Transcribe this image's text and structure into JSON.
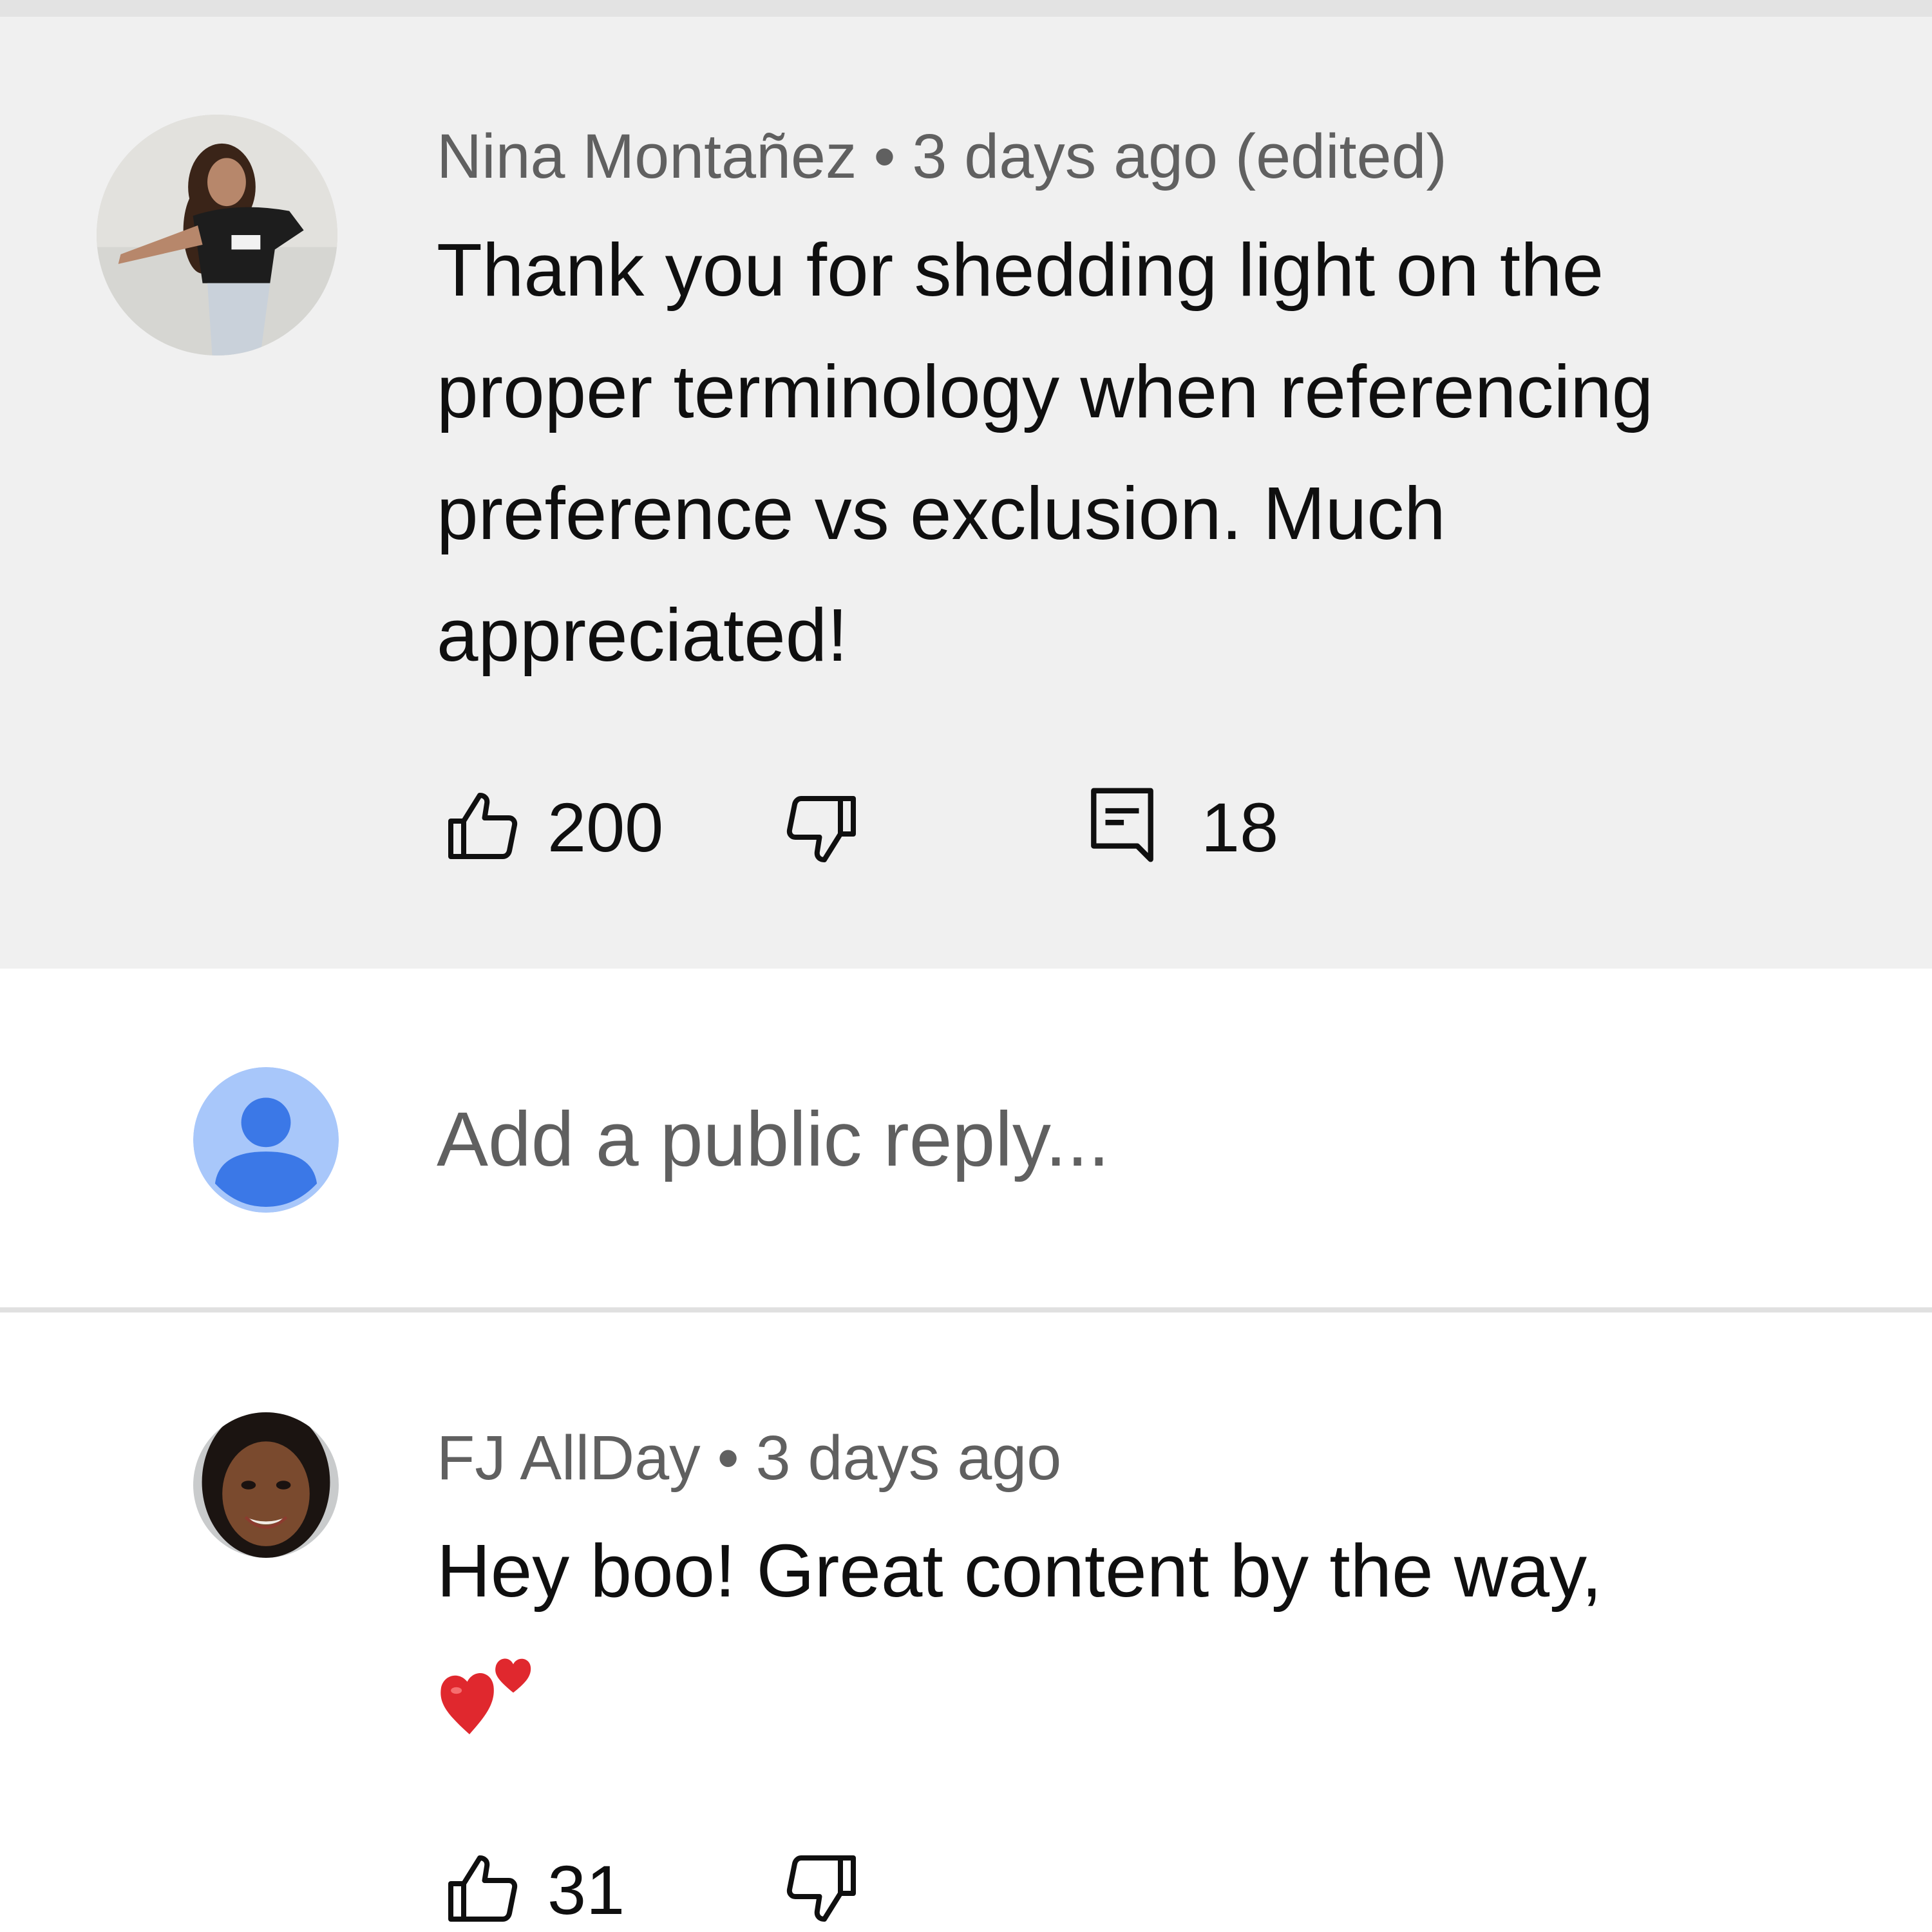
{
  "comments": [
    {
      "author": "Nina Montañez",
      "separator": "•",
      "time": "3 days ago (edited)",
      "lines": [
        "Thank you for shedding light on the",
        "proper terminology when referencing",
        "preference vs exclusion. Much",
        "appreciated!"
      ],
      "likes": "200",
      "replies": "18",
      "avatar": "user-photo"
    },
    {
      "author": "FJ AllDay",
      "separator": "•",
      "time": "3 days ago",
      "lines": [
        "Hey boo! Great content by the way,"
      ],
      "emoji": "two-hearts-emoji",
      "likes": "31",
      "avatar": "user-photo"
    }
  ],
  "reply_box": {
    "placeholder": "Add a public reply...",
    "avatar": "default-profile-icon",
    "avatar_color": "#4a86e8"
  },
  "icons": {
    "like": "thumb-up-icon",
    "dislike": "thumb-down-icon",
    "reply": "comment-icon"
  },
  "colors": {
    "highlight_bg": "#f0f0f0",
    "meta_text": "#606060",
    "body_text": "#0f0f0f",
    "emoji_red": "#e0282e"
  }
}
